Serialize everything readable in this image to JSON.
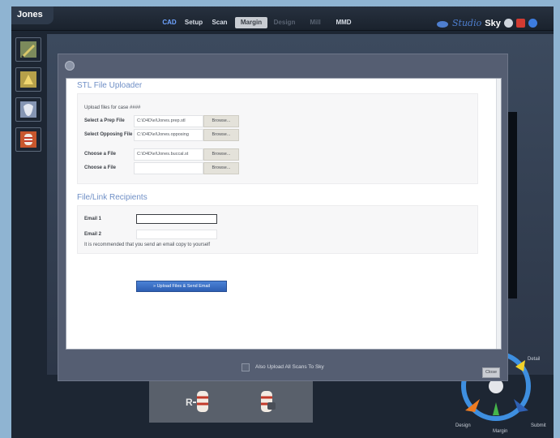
{
  "app": {
    "title": "Jones"
  },
  "tabs": [
    {
      "label": "CAD",
      "state": "blue"
    },
    {
      "label": "Setup",
      "state": "normal"
    },
    {
      "label": "Scan",
      "state": "normal"
    },
    {
      "label": "Margin",
      "state": "active"
    },
    {
      "label": "Design",
      "state": "dim"
    },
    {
      "label": "Mill",
      "state": "dim"
    },
    {
      "label": "MMD",
      "state": "normal"
    }
  ],
  "brand": {
    "studio": "Studio",
    "sky": "Sky"
  },
  "dialog": {
    "stl_section_title": "STL File Uploader",
    "upload_hint": "Upload files for case ####",
    "rows": [
      {
        "label": "Select a Prep File",
        "path": "C:\\D4D\\el\\Jones.prep.stl",
        "browse": "Browse..."
      },
      {
        "label": "Select Opposing File",
        "path": "C:\\D4D\\el\\Jones.opposing",
        "browse": "Browse..."
      },
      {
        "label": "Choose a File",
        "path": "C:\\D4D\\el\\Jones.buccal.st",
        "browse": "Browse..."
      },
      {
        "label": "Choose a File",
        "path": "",
        "browse": "Browse..."
      }
    ],
    "recipients_title": "File/Link Recipients",
    "email1_label": "Email 1",
    "email2_label": "Email 2",
    "email1_value": "",
    "email2_value": "",
    "recommend_note": "It is recommended that you send an email copy to yourself",
    "upload_button": "» Upload Files & Send Email",
    "also_upload_label": "Also Upload All Scans To Sky",
    "close_button": "Close"
  },
  "workflow_labels": {
    "top": "Detail",
    "left": "Design",
    "bottom": "Margin",
    "right": "Submit"
  }
}
